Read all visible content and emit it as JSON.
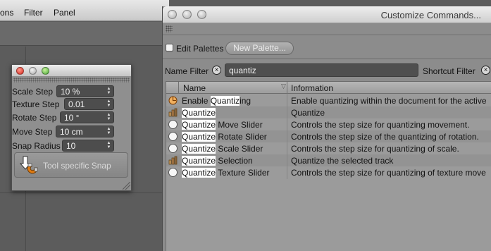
{
  "app_menubar": {
    "items": [
      "ons",
      "Filter",
      "Panel"
    ]
  },
  "snap_palette": {
    "fields": [
      {
        "label": "Scale Step",
        "value": "10 %"
      },
      {
        "label": "Texture Step",
        "value": "0.01"
      },
      {
        "label": "Rotate Step",
        "value": "10 °"
      },
      {
        "label": "Move Step",
        "value": "10 cm"
      },
      {
        "label": "Snap Radius",
        "value": "10"
      }
    ],
    "tool_button_label": "Tool specific Snap",
    "tool_button_icon": "magnet-arrow-icon"
  },
  "customize_commands": {
    "title": "Customize Commands...",
    "edit_palettes_label": "Edit Palettes",
    "edit_palettes_checked": false,
    "new_palette_label": "New Palette...",
    "name_filter_label": "Name Filter",
    "name_filter_value": "quantiz",
    "shortcut_filter_label": "Shortcut Filter",
    "columns": {
      "name": "Name",
      "information": "Information"
    },
    "rows": [
      {
        "icon": "quantize-toggle-icon",
        "pre": "Enable ",
        "match": "Quantiz",
        "post": "ing",
        "info": "Enable quantizing within the document for the active"
      },
      {
        "icon": "quantize-track-icon",
        "pre": "",
        "match": "Quantize",
        "post": "",
        "info": "Quantize"
      },
      {
        "icon": "circle-icon",
        "pre": "",
        "match": "Quantize",
        "post": " Move Slider",
        "info": "Controls the step size for quantizing movement."
      },
      {
        "icon": "circle-icon",
        "pre": "",
        "match": "Quantize",
        "post": " Rotate Slider",
        "info": "Controls the step size of the quantizing of rotation."
      },
      {
        "icon": "circle-icon",
        "pre": "",
        "match": "Quantize",
        "post": " Scale Slider",
        "info": "Controls the step size for quantizing of scale."
      },
      {
        "icon": "quantize-track-icon",
        "pre": "",
        "match": "Quantize",
        "post": " Selection",
        "info": "Quantize the selected track"
      },
      {
        "icon": "circle-icon",
        "pre": "",
        "match": "Quantize",
        "post": " Texture Slider",
        "info": "Controls the step size for quantizing of texture move"
      }
    ]
  }
}
